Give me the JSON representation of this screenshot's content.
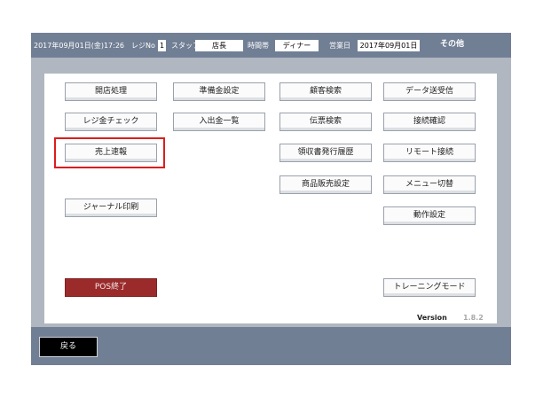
{
  "header": {
    "datetime": "2017年09月01日(金)17:26",
    "register_label": "レジNo",
    "register_value": "1",
    "staff_label": "スタッフ",
    "staff_value": "店長",
    "time_slot_label": "時間帯",
    "time_slot_value": "ディナー",
    "business_day_label": "営業日",
    "business_day_value": "2017年09月01日",
    "screen_title": "その他"
  },
  "buttons": {
    "store_open": "開店処理",
    "reserve_setting": "準備金設定",
    "customer_search": "顧客検索",
    "data_transfer": "データ送受信",
    "register_check": "レジ金チェック",
    "cash_io_list": "入出金一覧",
    "slip_search": "伝票検索",
    "connection_check": "接続確認",
    "sales_report": "売上速報",
    "receipt_history": "領収書発行履歴",
    "remote_connect": "リモート接続",
    "product_sales_setting": "商品販売設定",
    "menu_switch": "メニュー切替",
    "journal_print": "ジャーナル印刷",
    "operation_setting": "動作設定",
    "pos_exit": "POS終了",
    "training_mode": "トレーニングモード"
  },
  "version": {
    "label": "Version",
    "value": "1.8.2"
  },
  "footer": {
    "back_label": "戻る"
  },
  "colors": {
    "bar": "#717f95",
    "frame": "#b0b7c1",
    "highlight": "#dc1d1d",
    "exit_button": "#9b2b2b"
  }
}
